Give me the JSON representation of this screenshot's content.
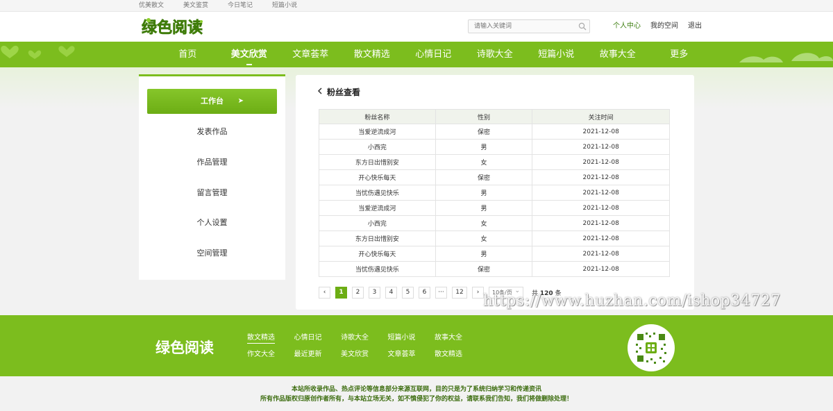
{
  "top_links": [
    "优美散文",
    "美文鉴赏",
    "今日笔记",
    "短篇小说"
  ],
  "logo_text": "绿色阅读",
  "search": {
    "placeholder": "请输入关键词"
  },
  "user_links": [
    "个人中心",
    "我的空间",
    "退出"
  ],
  "nav": [
    "首页",
    "美文欣赏",
    "文章荟萃",
    "散文精选",
    "心情日记",
    "诗歌大全",
    "短篇小说",
    "故事大全",
    "更多"
  ],
  "sidebar": [
    "工作台",
    "发表作品",
    "作品管理",
    "留言管理",
    "个人设置",
    "空间管理"
  ],
  "panel": {
    "title": "粉丝查看",
    "columns": [
      "粉丝名称",
      "性别",
      "关注时间"
    ],
    "rows": [
      [
        "当爱逆流成河",
        "保密",
        "2021-12-08"
      ],
      [
        "小西完",
        "男",
        "2021-12-08"
      ],
      [
        "东方日出惜别安",
        "女",
        "2021-12-08"
      ],
      [
        "开心快乐每天",
        "保密",
        "2021-12-08"
      ],
      [
        "当忧伤遇见快乐",
        "男",
        "2021-12-08"
      ],
      [
        "当爱逆流成河",
        "男",
        "2021-12-08"
      ],
      [
        "小西完",
        "女",
        "2021-12-08"
      ],
      [
        "东方日出惜别安",
        "女",
        "2021-12-08"
      ],
      [
        "开心快乐每天",
        "男",
        "2021-12-08"
      ],
      [
        "当忧伤遇见快乐",
        "保密",
        "2021-12-08"
      ]
    ]
  },
  "pagination": {
    "pages": [
      "1",
      "2",
      "3",
      "4",
      "5",
      "6",
      "···",
      "12"
    ],
    "current": "1",
    "page_size": "10条/页",
    "total_prefix": "共",
    "total": "120",
    "total_suffix": "条"
  },
  "watermark": "https://www.huzhan.com/ishop34727",
  "footer": {
    "links": [
      "散文精选",
      "心情日记",
      "诗歌大全",
      "短篇小说",
      "故事大全",
      "作文大全",
      "最近更新",
      "美文欣赏",
      "文章荟萃",
      "散文精选"
    ],
    "copyright": [
      "本站所收录作品、热点评论等信息部分来源互联网，目的只是为了系统归纳学习和传递资讯",
      "所有作品版权归原创作者所有，与本站立场无关，如不慎侵犯了你的权益，请联系我们告知，我们将做删除处理！"
    ]
  },
  "colors": {
    "brand_green": "#7cbd1e",
    "active_green": "#6cad14",
    "text_dark_green": "#3d7e10"
  }
}
